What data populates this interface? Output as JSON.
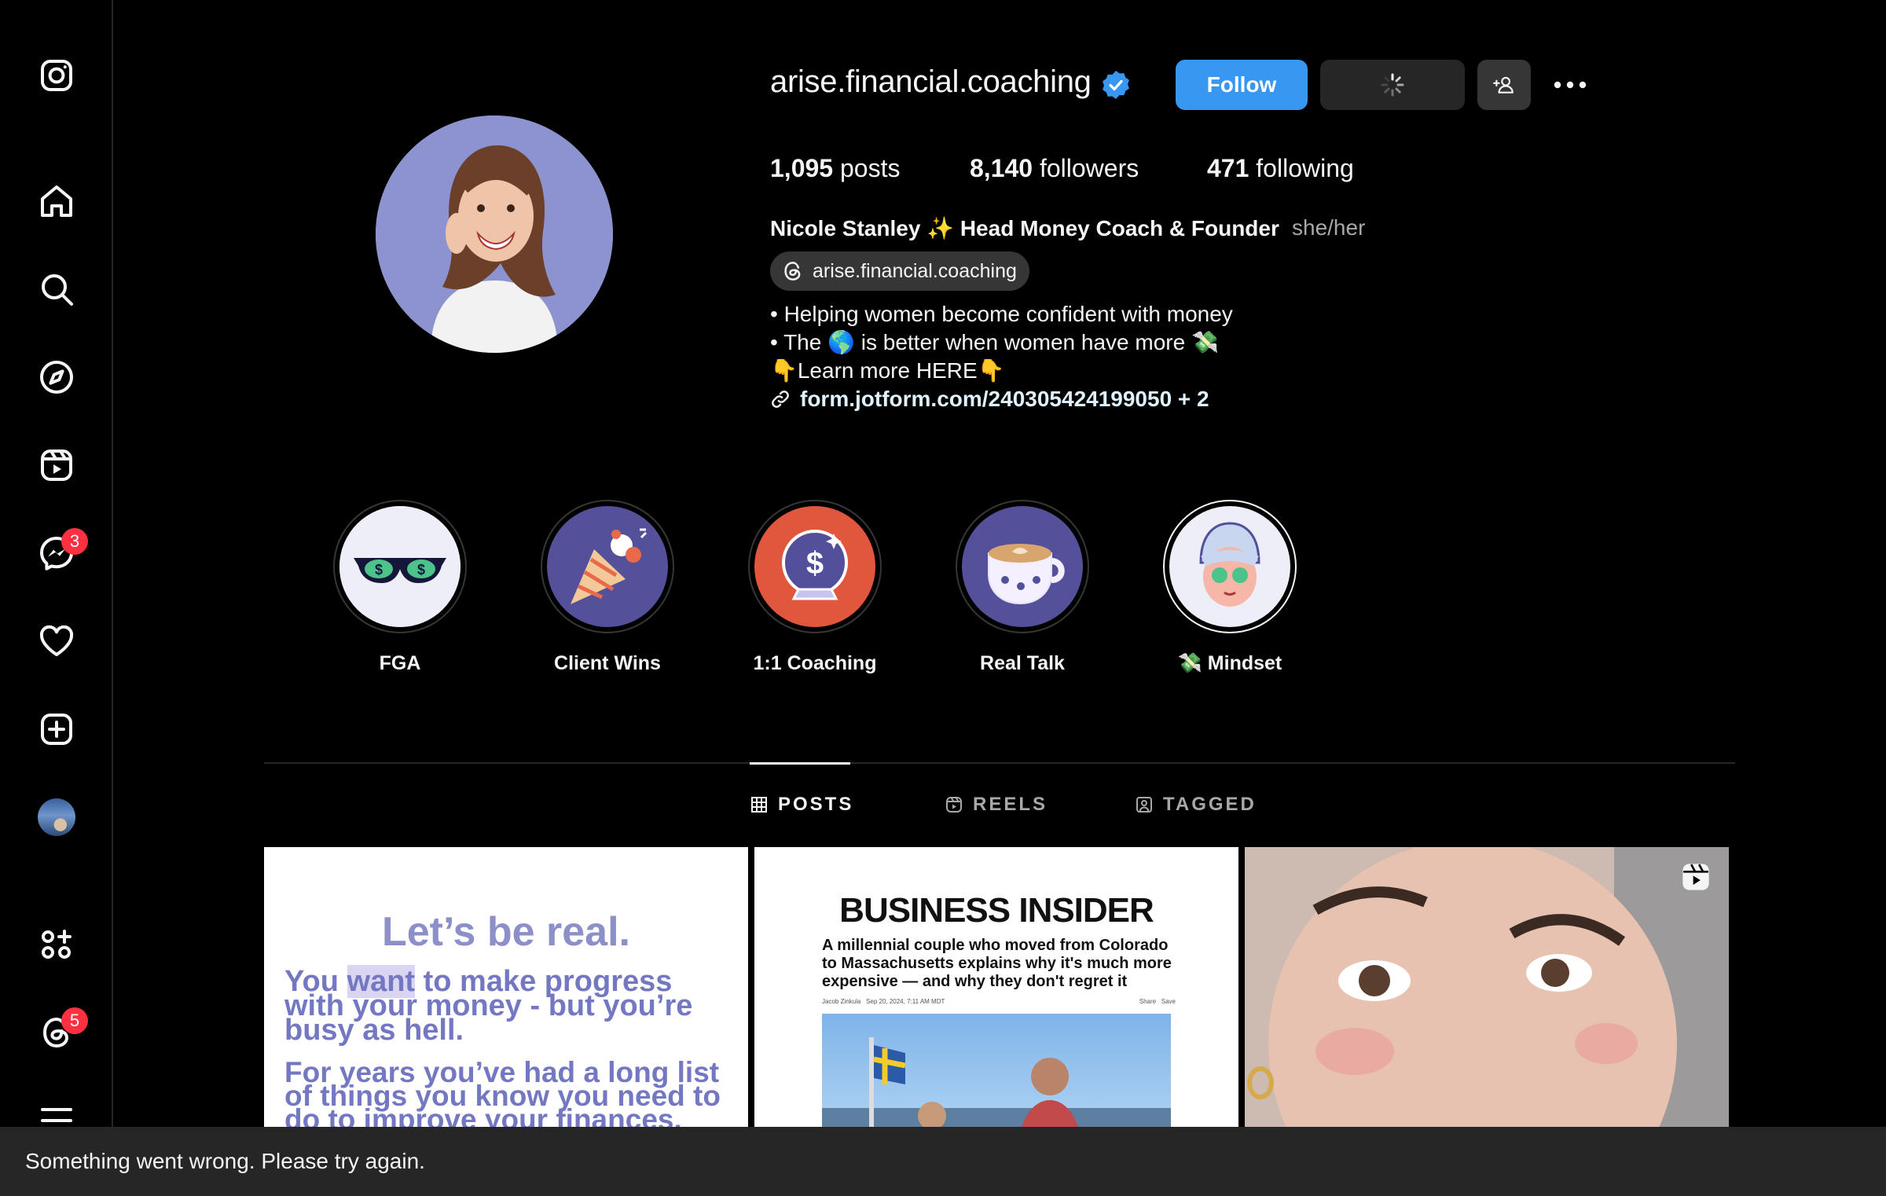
{
  "sidebar": {
    "items": [
      {
        "name": "instagram-logo-icon"
      },
      {
        "name": "home-icon"
      },
      {
        "name": "search-icon"
      },
      {
        "name": "explore-icon"
      },
      {
        "name": "reels-icon"
      },
      {
        "name": "messenger-icon",
        "badge": "3"
      },
      {
        "name": "notifications-heart-icon"
      },
      {
        "name": "create-icon"
      },
      {
        "name": "profile-avatar"
      },
      {
        "name": "apps-icon"
      },
      {
        "name": "threads-icon",
        "badge": "5"
      },
      {
        "name": "menu-icon"
      }
    ]
  },
  "profile": {
    "username": "arise.financial.coaching",
    "verified": true,
    "follow_label": "Follow",
    "stats": {
      "posts_count": "1,095",
      "posts_label": "posts",
      "followers_count": "8,140",
      "followers_label": "followers",
      "following_count": "471",
      "following_label": "following"
    },
    "full_name": "Nicole Stanley ✨ Head Money Coach & Founder",
    "pronouns": "she/her",
    "threads_handle": "arise.financial.coaching",
    "bio": [
      "• Helping women become confident with money",
      "• The 🌎 is better when women have more 💸",
      "👇Learn more HERE👇"
    ],
    "link": "form.jotform.com/240305424199050 + 2"
  },
  "highlights": [
    {
      "label": "FGA",
      "icon": "sunglasses-icon"
    },
    {
      "label": "Client Wins",
      "icon": "party-popper-icon"
    },
    {
      "label": "1:1 Coaching",
      "icon": "crystal-ball-icon"
    },
    {
      "label": "Real Talk",
      "icon": "coffee-cup-icon"
    },
    {
      "label": "💸 Mindset",
      "icon": "face-mask-icon"
    }
  ],
  "tabs": [
    {
      "label": "POSTS",
      "active": true
    },
    {
      "label": "REELS",
      "active": false
    },
    {
      "label": "TAGGED",
      "active": false
    }
  ],
  "posts": {
    "post1": {
      "title": "Let’s be real.",
      "body_pre": "You ",
      "body_highlight": "want",
      "body_post": " to make progress with your money - but you’re busy as hell.",
      "body2": "For years you’ve had a long list of things you know you need to do to improve your finances."
    },
    "post2": {
      "masthead": "BUSINESS INSIDER",
      "headline": "A millennial couple who moved from Colorado to Massachusetts explains why it's much more expensive — and why they don't regret it",
      "byline": "Jacob Zinkula",
      "date": "Sep 20, 2024, 7:11 AM MDT",
      "share": "Share",
      "save": "Save"
    },
    "post3": {
      "type": "reel"
    }
  },
  "toast": {
    "message": "Something went wrong. Please try again."
  },
  "colors": {
    "accent": "#3897f0",
    "badge": "#ff3040",
    "background": "#000000"
  }
}
